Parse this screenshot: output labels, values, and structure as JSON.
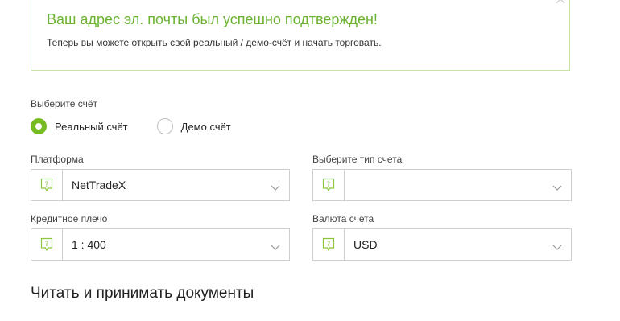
{
  "banner": {
    "title": "Ваш адрес эл. почты был успешно подтвержден!",
    "text": "Теперь вы можете открыть свой реальный / демо-счёт и начать торговать."
  },
  "account_type": {
    "label": "Выберите счёт",
    "options": [
      {
        "label": "Реальный счёт",
        "checked": true
      },
      {
        "label": "Демо счёт",
        "checked": false
      }
    ]
  },
  "platform": {
    "label": "Платформа",
    "value": "NetTradeX"
  },
  "account_kind": {
    "label": "Выберите тип счета",
    "value": ""
  },
  "leverage": {
    "label": "Кредитное плечо",
    "value": "1 : 400"
  },
  "currency": {
    "label": "Валюта счета",
    "value": "USD"
  },
  "documents": {
    "title": "Читать и принимать документы"
  },
  "colors": {
    "accent": "#76bc21",
    "success_text": "#6bb230",
    "banner_border": "#c6e3a5",
    "field_border": "#cfcfcf"
  }
}
